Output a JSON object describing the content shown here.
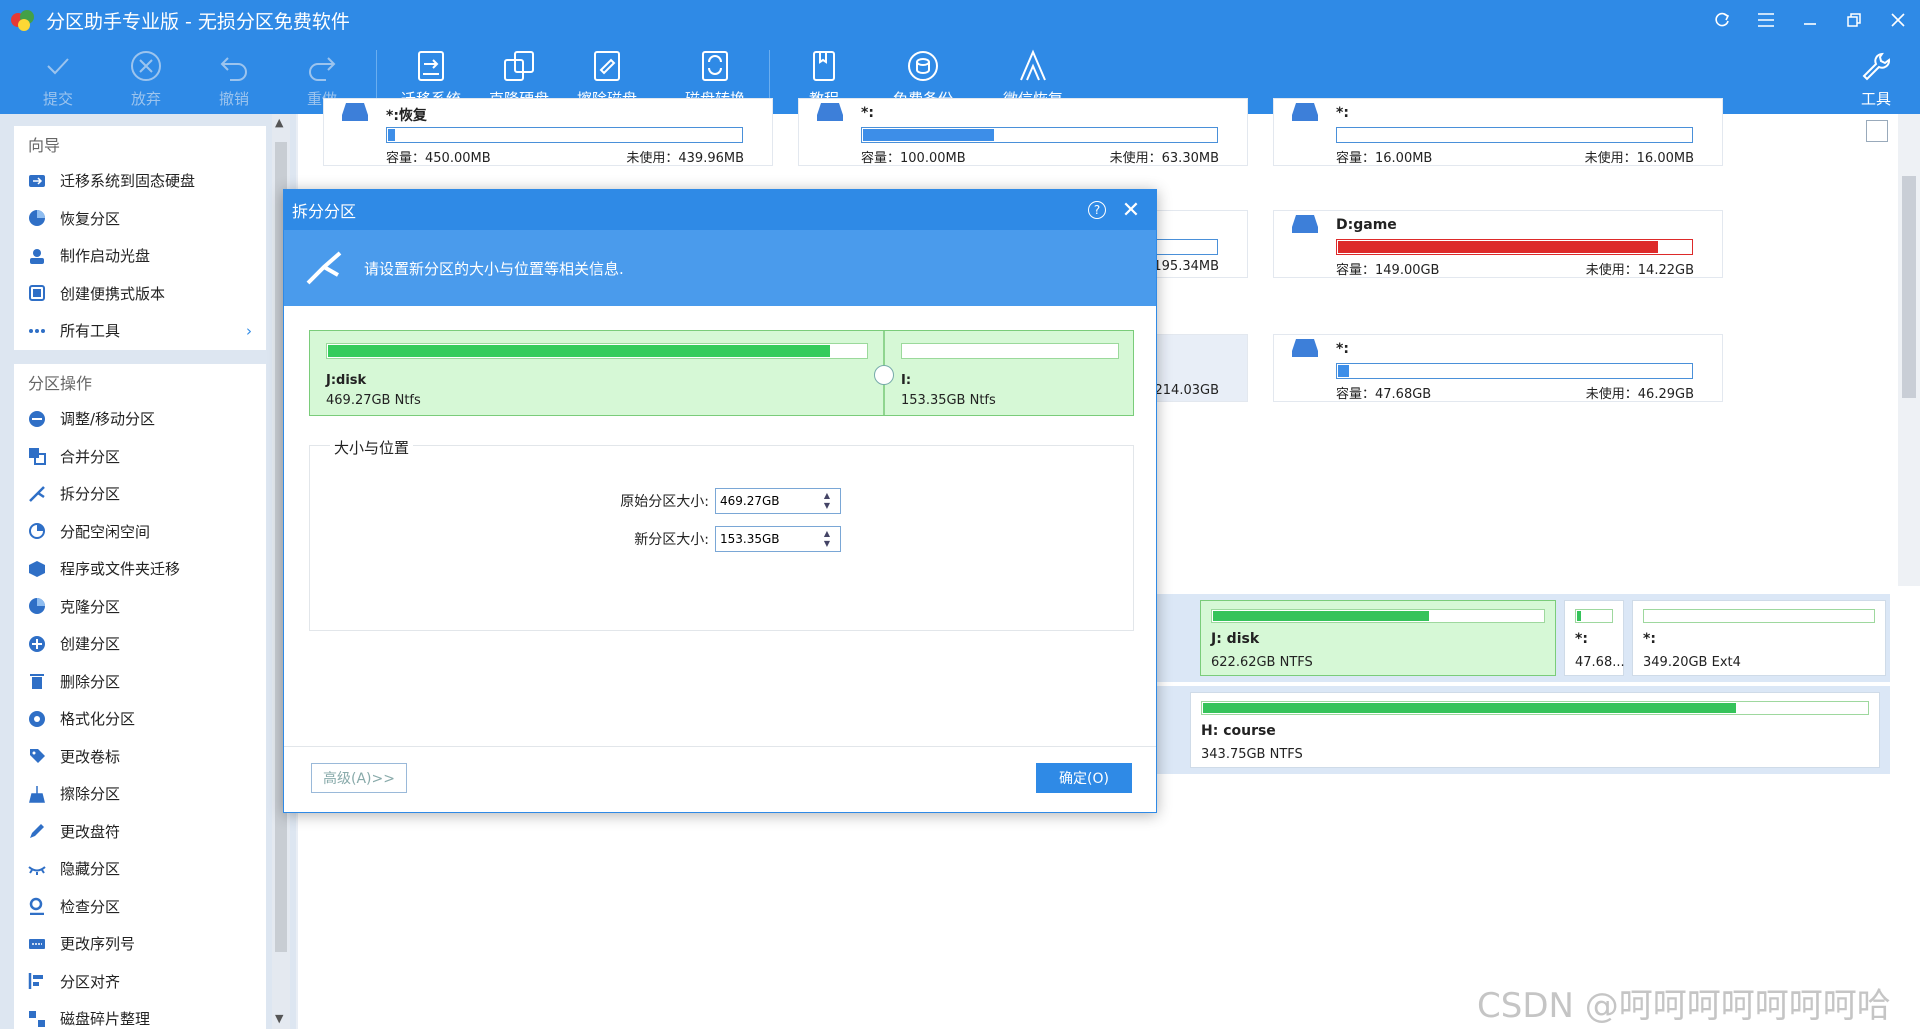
{
  "window": {
    "title": "分区助手专业版 - 无损分区免费软件"
  },
  "toolbar": {
    "buttons": [
      {
        "label": "提交",
        "icon": "check-icon"
      },
      {
        "label": "放弃",
        "icon": "cancel-icon"
      },
      {
        "label": "撤销",
        "icon": "undo-icon"
      },
      {
        "label": "重做",
        "icon": "redo-icon"
      },
      {
        "label": "迁移系统",
        "icon": "migrate-icon"
      },
      {
        "label": "克隆硬盘",
        "icon": "clone-disk-icon"
      },
      {
        "label": "擦除磁盘",
        "icon": "wipe-disk-icon"
      },
      {
        "label": "磁盘转换",
        "icon": "convert-icon"
      },
      {
        "label": "教程",
        "icon": "book-icon"
      },
      {
        "label": "免费备份",
        "icon": "backup-icon"
      },
      {
        "label": "微信恢复",
        "icon": "recover-icon"
      },
      {
        "label": "工具",
        "icon": "wrench-icon"
      }
    ]
  },
  "sidebar": {
    "guide_title": "向导",
    "guide_items": [
      {
        "label": "迁移系统到固态硬盘"
      },
      {
        "label": "恢复分区"
      },
      {
        "label": "制作启动光盘"
      },
      {
        "label": "创建便携式版本"
      },
      {
        "label": "所有工具"
      }
    ],
    "ops_title": "分区操作",
    "ops_items": [
      {
        "label": "调整/移动分区"
      },
      {
        "label": "合并分区"
      },
      {
        "label": "拆分分区"
      },
      {
        "label": "分配空闲空间"
      },
      {
        "label": "程序或文件夹迁移"
      },
      {
        "label": "克隆分区"
      },
      {
        "label": "创建分区"
      },
      {
        "label": "删除分区"
      },
      {
        "label": "格式化分区"
      },
      {
        "label": "更改卷标"
      },
      {
        "label": "擦除分区"
      },
      {
        "label": "更改盘符"
      },
      {
        "label": "隐藏分区"
      },
      {
        "label": "检查分区"
      },
      {
        "label": "更改序列号"
      },
      {
        "label": "分区对齐"
      },
      {
        "label": "磁盘碎片整理"
      }
    ]
  },
  "partitions": [
    {
      "name": "*:恢复",
      "cap": "容量：450.00MB",
      "free": "未使用：439.96MB",
      "used": 0.02
    },
    {
      "name": "*:",
      "cap": "容量：100.00MB",
      "free": "未使用：63.30MB",
      "used": 0.37
    },
    {
      "name": "*:",
      "cap": "容量：16.00MB",
      "free": "未使用：16.00MB",
      "used": 0.0
    },
    {
      "name": "",
      "cap": "",
      "free": "195.34MB",
      "used": 0.0
    },
    {
      "name": "D:game",
      "cap": "容量：149.00GB",
      "free": "未使用：14.22GB",
      "used": 0.9
    },
    {
      "name": "",
      "cap": "",
      "free": "214.03GB",
      "used": 0.0
    },
    {
      "name": "*:",
      "cap": "容量：47.68GB",
      "free": "未使用：46.29GB",
      "used": 0.03
    }
  ],
  "disk_rows": [
    [
      {
        "name": "J: disk",
        "size": "622.62GB NTFS",
        "used": 0.65,
        "selected": true
      },
      {
        "name": "*:",
        "size": "47.68...",
        "used": 0.1,
        "selected": false
      },
      {
        "name": "*:",
        "size": "349.20GB Ext4",
        "used": 0.0,
        "selected": false
      }
    ],
    [
      {
        "name": "H: course",
        "size": "343.75GB NTFS",
        "used": 0.8,
        "selected": false
      }
    ]
  ],
  "dialog": {
    "title": "拆分分区",
    "banner": "请设置新分区的大小与位置等相关信息.",
    "left": {
      "name": "J:disk",
      "size": "469.27GB Ntfs",
      "used": 0.93
    },
    "right": {
      "name": "I:",
      "size": "153.35GB Ntfs",
      "used": 0.0
    },
    "group_title": "大小与位置",
    "orig_label": "原始分区大小:",
    "orig_value": "469.27GB",
    "new_label": "新分区大小:",
    "new_value": "153.35GB",
    "advanced": "高级(A)>>",
    "ok": "确定(O)"
  },
  "watermark": "CSDN @呵呵呵呵呵呵呵哈",
  "colors": {
    "accent": "#2f8ae6",
    "green": "#35c35a",
    "red": "#dd2a2a"
  }
}
